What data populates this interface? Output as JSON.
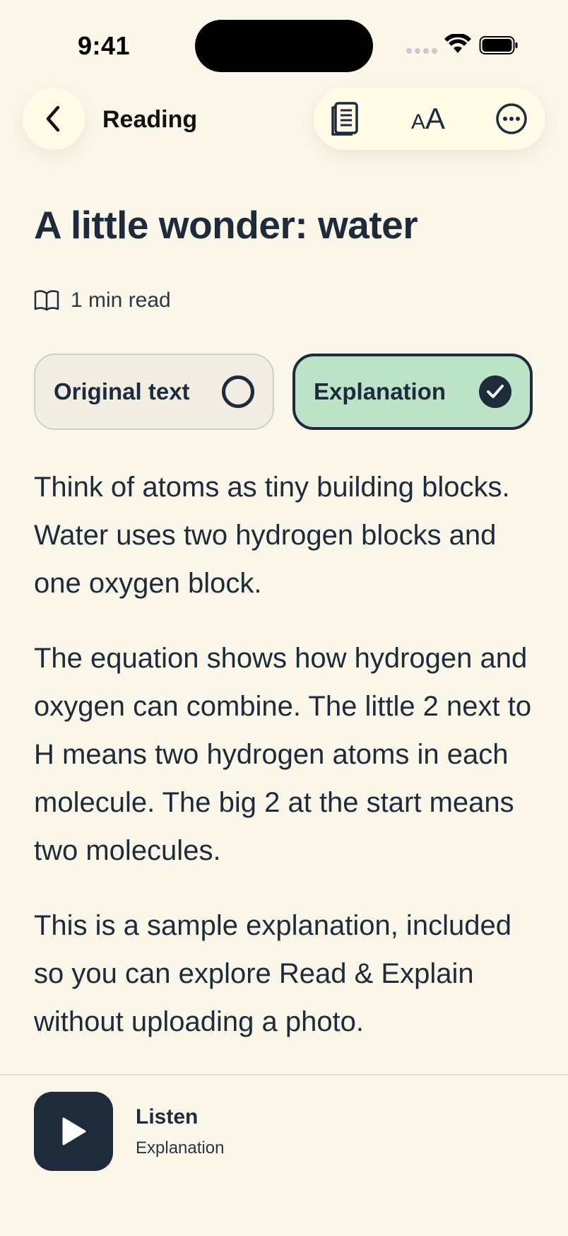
{
  "status_bar": {
    "time": "9:41"
  },
  "header": {
    "title": "Reading",
    "back_icon": "chevron-left-icon",
    "tools": [
      "document-icon",
      "text-size-icon",
      "more-icon"
    ],
    "text_size_glyph_small": "A",
    "text_size_glyph_large": "A"
  },
  "article": {
    "title": "A little wonder: water",
    "read_time": "1 min read"
  },
  "view_toggle": {
    "original_label": "Original text",
    "explanation_label": "Explanation",
    "selected": "explanation"
  },
  "body": {
    "paragraphs": [
      "Think of atoms as tiny building blocks. Water uses two hydrogen blocks and one oxygen block.",
      "The equation shows how hydrogen and oxygen can combine. The little 2 next to H means two hydrogen atoms in each molecule. The big 2 at the start means two molecules.",
      "This is a sample explanation, included so you can explore Read & Explain without uploading a photo."
    ]
  },
  "player": {
    "label": "Listen",
    "sublabel": "Explanation"
  },
  "colors": {
    "background": "#fbf6ea",
    "ink": "#1d2b3a",
    "selected_card": "#bce2c8",
    "chip_bg": "#fffbe7"
  }
}
